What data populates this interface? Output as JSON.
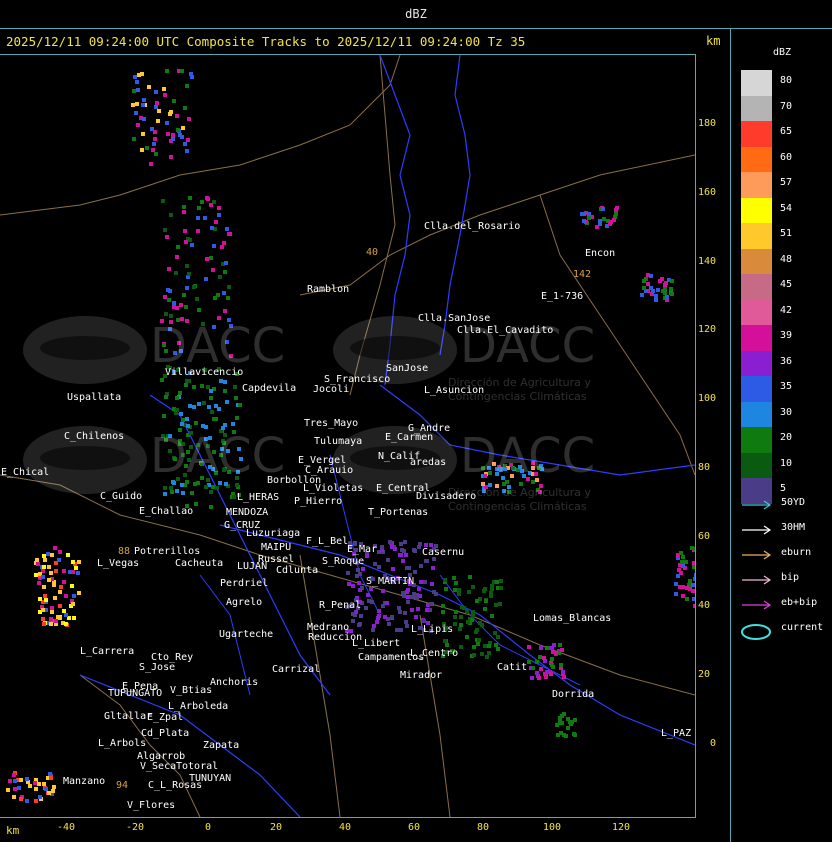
{
  "window": {
    "title": "dBZ"
  },
  "header": {
    "text": "2025/12/11 09:24:00 UTC Composite Tracks to 2025/12/11 09:24:00 Tz 35",
    "km": "km"
  },
  "axis": {
    "y_unit": "km",
    "x_unit": "km",
    "y_ticks": [
      "180",
      "160",
      "140",
      "120",
      "100",
      "80",
      "60",
      "40",
      "20",
      "0"
    ],
    "x_ticks": [
      "-40",
      "-20",
      "0",
      "20",
      "40",
      "60",
      "80",
      "100",
      "120"
    ]
  },
  "legend": {
    "title": "dBZ",
    "levels": [
      {
        "value": "80",
        "color": "#d6d6d6"
      },
      {
        "value": "70",
        "color": "#b4b4b4"
      },
      {
        "value": "65",
        "color": "#ff3b2b"
      },
      {
        "value": "60",
        "color": "#ff6a12"
      },
      {
        "value": "57",
        "color": "#ff9b5a"
      },
      {
        "value": "54",
        "color": "#ffff00"
      },
      {
        "value": "51",
        "color": "#ffc82b"
      },
      {
        "value": "48",
        "color": "#d98a3a"
      },
      {
        "value": "45",
        "color": "#c76a86"
      },
      {
        "value": "42",
        "color": "#e05a9a"
      },
      {
        "value": "39",
        "color": "#d40f9a"
      },
      {
        "value": "36",
        "color": "#8a1fd2"
      },
      {
        "value": "35",
        "color": "#2e5be6"
      },
      {
        "value": "30",
        "color": "#1e86e0"
      },
      {
        "value": "20",
        "color": "#0f7a0f"
      },
      {
        "value": "10",
        "color": "#0a5a12"
      },
      {
        "value": "5",
        "color": "#4a3c86"
      }
    ]
  },
  "tracks": [
    {
      "label": "50YD",
      "color": "#40c8d8"
    },
    {
      "label": "30HM",
      "color": "#ffffff"
    },
    {
      "label": "eburn",
      "color": "#e8b060"
    },
    {
      "label": "bip",
      "color": "#f4b6d8"
    },
    {
      "label": "eb+bip",
      "color": "#e040e0"
    },
    {
      "label": "current",
      "color": "#40e0e0"
    }
  ],
  "places": [
    {
      "name": "Clla.del_Rosario"
    },
    {
      "name": "Ramblon"
    },
    {
      "name": "Clla.SanJose"
    },
    {
      "name": "Clla.El_Cavadito"
    },
    {
      "name": "Encon"
    },
    {
      "name": "E_1-736"
    },
    {
      "name": "Villavicencio"
    },
    {
      "name": "Uspallata"
    },
    {
      "name": "Capdevila"
    },
    {
      "name": "S_Francisco"
    },
    {
      "name": "Jocoli"
    },
    {
      "name": "SanJose"
    },
    {
      "name": "L_Asuncion"
    },
    {
      "name": "Tres_Mayo"
    },
    {
      "name": "Tulumaya"
    },
    {
      "name": "G_Andre"
    },
    {
      "name": "E_Carmen"
    },
    {
      "name": "C_Chilenos"
    },
    {
      "name": "E_Chical"
    },
    {
      "name": "E_Vergel"
    },
    {
      "name": "C_Arauio"
    },
    {
      "name": "N_Calif"
    },
    {
      "name": "aredas"
    },
    {
      "name": "Borbollon"
    },
    {
      "name": "L_Violetas"
    },
    {
      "name": "E_Central"
    },
    {
      "name": "Divisadero"
    },
    {
      "name": "C_Guido"
    },
    {
      "name": "L_HERAS"
    },
    {
      "name": "P_Hierro"
    },
    {
      "name": "E_Challao"
    },
    {
      "name": "MENDOZA"
    },
    {
      "name": "G_CRUZ"
    },
    {
      "name": "Luzuriaga"
    },
    {
      "name": "T_Portenas"
    },
    {
      "name": "Potrerillos"
    },
    {
      "name": "Cacheuta"
    },
    {
      "name": "L_Vegas"
    },
    {
      "name": "MAIPU"
    },
    {
      "name": "Russel"
    },
    {
      "name": "LUJAN"
    },
    {
      "name": "Cdlunta"
    },
    {
      "name": "S_Roque"
    },
    {
      "name": "Perdriel"
    },
    {
      "name": "Agrelo"
    },
    {
      "name": "F_L_Bel"
    },
    {
      "name": "E_Mar"
    },
    {
      "name": "R_Penal"
    },
    {
      "name": "Casernu"
    },
    {
      "name": "S_MARTIN"
    },
    {
      "name": "Lomas_Blancas"
    },
    {
      "name": "Ugarteche"
    },
    {
      "name": "L_Carrera"
    },
    {
      "name": "Cto_Rey"
    },
    {
      "name": "S_Jose"
    },
    {
      "name": "Medrano"
    },
    {
      "name": "Reduccion"
    },
    {
      "name": "L_Libert"
    },
    {
      "name": "Campamentos"
    },
    {
      "name": "L_Centro"
    },
    {
      "name": "Catit"
    },
    {
      "name": "E_Pena"
    },
    {
      "name": "TUPUNGATO"
    },
    {
      "name": "V_Btias"
    },
    {
      "name": "Anchoris"
    },
    {
      "name": "Carrizal"
    },
    {
      "name": "Mirador"
    },
    {
      "name": "Dorrida"
    },
    {
      "name": "Gltallar"
    },
    {
      "name": "E_Zpal"
    },
    {
      "name": "L_Arboleda"
    },
    {
      "name": "Cd_Plata"
    },
    {
      "name": "Zapata"
    },
    {
      "name": "L_Arbols"
    },
    {
      "name": "Algarrob"
    },
    {
      "name": "V_Seca"
    },
    {
      "name": "Totoral"
    },
    {
      "name": "TUNUYAN"
    },
    {
      "name": "Manzano"
    },
    {
      "name": "C_L_Rosas"
    },
    {
      "name": "V_Flores"
    },
    {
      "name": "L_PAZ"
    },
    {
      "name": "L_Lipis"
    }
  ],
  "route_numbers": [
    "40",
    "142",
    "88",
    "94"
  ],
  "watermarks": [
    {
      "name": "DACC",
      "subtitle": "Dirección de Agricultura y Contingencias Climáticas"
    }
  ]
}
